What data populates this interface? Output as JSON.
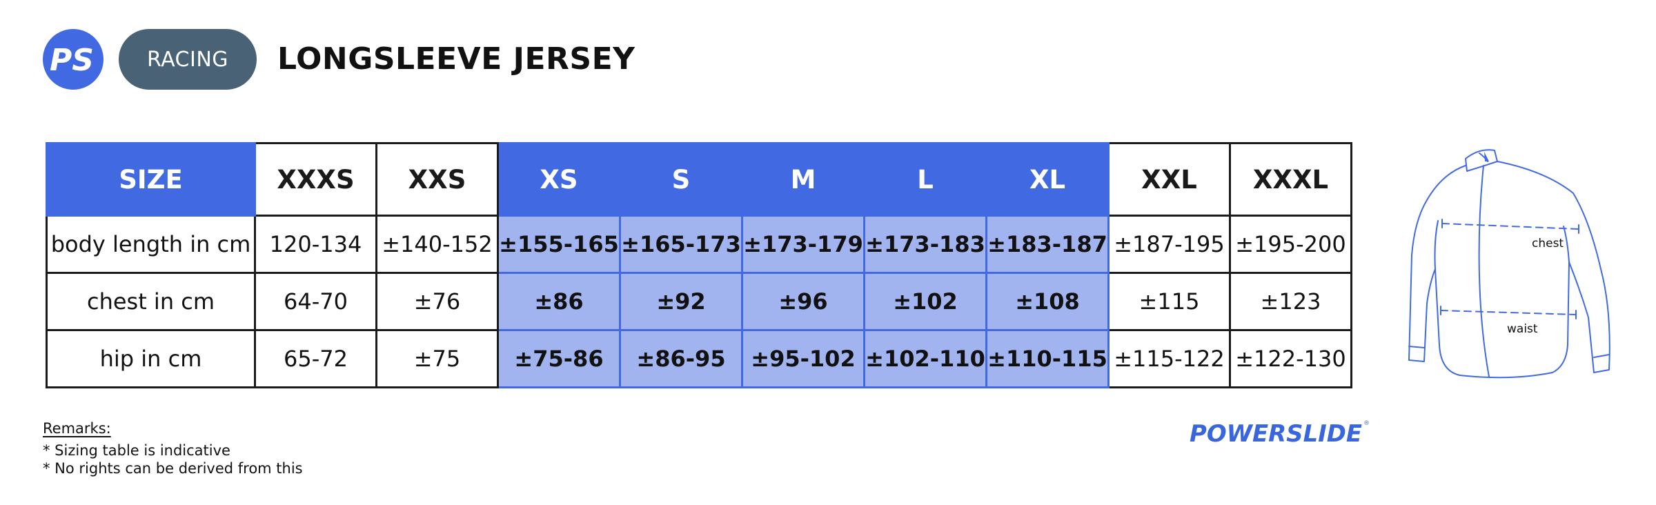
{
  "header": {
    "logo_text": "PS",
    "category": "RACING",
    "title": "LONGSLEEVE JERSEY"
  },
  "table": {
    "headers": [
      "SIZE",
      "XXXS",
      "XXS",
      "XS",
      "S",
      "M",
      "L",
      "XL",
      "XXL",
      "XXXL"
    ],
    "rows": [
      {
        "label": "body length in cm",
        "values": [
          "120-134",
          "±140-152",
          "±155-165",
          "±165-173",
          "±173-179",
          "±173-183",
          "±183-187",
          "±187-195",
          "±195-200"
        ]
      },
      {
        "label": "chest in cm",
        "values": [
          "64-70",
          "±76",
          "±86",
          "±92",
          "±96",
          "±102",
          "±108",
          "±115",
          "±123"
        ]
      },
      {
        "label": "hip in cm",
        "values": [
          "65-72",
          "±75",
          "±75-86",
          "±86-95",
          "±95-102",
          "±102-110",
          "±110-115",
          "±115-122",
          "±122-130"
        ]
      }
    ],
    "highlighted_sizes": [
      "XS",
      "S",
      "M",
      "L",
      "XL"
    ]
  },
  "remarks": {
    "title": "Remarks:",
    "lines": [
      "* Sizing table is indicative",
      "* No rights can be derived from this"
    ]
  },
  "brand": {
    "name": "POWERSLIDE"
  },
  "diagram": {
    "chest_label": "chest",
    "waist_label": "waist"
  },
  "colors": {
    "accent": "#4169e1",
    "highlight": "#a1b4f0",
    "pill": "#4a6276"
  }
}
